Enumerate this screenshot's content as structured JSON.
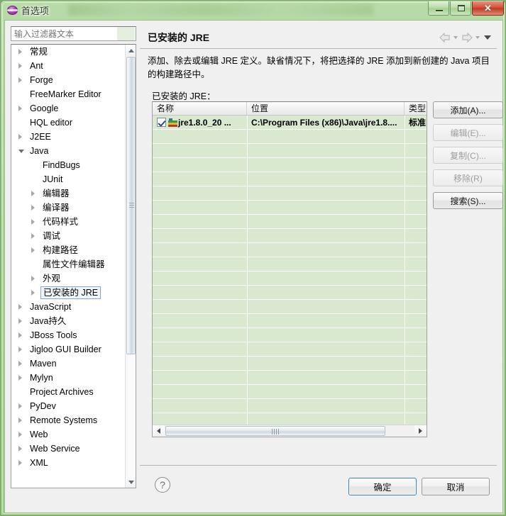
{
  "window": {
    "title": "首选项",
    "icon": "preferences-ball-icon",
    "controls": {
      "minimize": "minimize-icon",
      "maximize": "maximize-icon",
      "close": "✕"
    }
  },
  "sidebar": {
    "filter": {
      "placeholder": "输入过滤器文本",
      "value": ""
    },
    "items": [
      {
        "label": "常规",
        "indent": 0,
        "arrow": "collapsed"
      },
      {
        "label": "Ant",
        "indent": 0,
        "arrow": "collapsed"
      },
      {
        "label": "Forge",
        "indent": 0,
        "arrow": "collapsed"
      },
      {
        "label": "FreeMarker Editor",
        "indent": 0,
        "arrow": "none"
      },
      {
        "label": "Google",
        "indent": 0,
        "arrow": "collapsed"
      },
      {
        "label": "HQL editor",
        "indent": 0,
        "arrow": "none"
      },
      {
        "label": "J2EE",
        "indent": 0,
        "arrow": "collapsed"
      },
      {
        "label": "Java",
        "indent": 0,
        "arrow": "expanded"
      },
      {
        "label": "FindBugs",
        "indent": 1,
        "arrow": "none"
      },
      {
        "label": "JUnit",
        "indent": 1,
        "arrow": "none"
      },
      {
        "label": "编辑器",
        "indent": 1,
        "arrow": "collapsed"
      },
      {
        "label": "编译器",
        "indent": 1,
        "arrow": "collapsed"
      },
      {
        "label": "代码样式",
        "indent": 1,
        "arrow": "collapsed"
      },
      {
        "label": "调试",
        "indent": 1,
        "arrow": "collapsed"
      },
      {
        "label": "构建路径",
        "indent": 1,
        "arrow": "collapsed"
      },
      {
        "label": "属性文件编辑器",
        "indent": 1,
        "arrow": "none"
      },
      {
        "label": "外观",
        "indent": 1,
        "arrow": "collapsed"
      },
      {
        "label": "已安装的 JRE",
        "indent": 1,
        "arrow": "collapsed",
        "selected": true
      },
      {
        "label": "JavaScript",
        "indent": 0,
        "arrow": "collapsed"
      },
      {
        "label": "Java持久",
        "indent": 0,
        "arrow": "collapsed"
      },
      {
        "label": "JBoss Tools",
        "indent": 0,
        "arrow": "collapsed"
      },
      {
        "label": "Jigloo GUI Builder",
        "indent": 0,
        "arrow": "collapsed"
      },
      {
        "label": "Maven",
        "indent": 0,
        "arrow": "collapsed"
      },
      {
        "label": "Mylyn",
        "indent": 0,
        "arrow": "collapsed"
      },
      {
        "label": "Project Archives",
        "indent": 0,
        "arrow": "none"
      },
      {
        "label": "PyDev",
        "indent": 0,
        "arrow": "collapsed"
      },
      {
        "label": "Remote Systems",
        "indent": 0,
        "arrow": "collapsed"
      },
      {
        "label": "Web",
        "indent": 0,
        "arrow": "collapsed"
      },
      {
        "label": "Web Service",
        "indent": 0,
        "arrow": "collapsed"
      },
      {
        "label": "XML",
        "indent": 0,
        "arrow": "collapsed"
      }
    ]
  },
  "page": {
    "title": "已安装的 JRE",
    "description": "添加、除去或编辑 JRE 定义。缺省情况下，将把选择的 JRE 添加到新创建的 Java 项目的构建路径中。",
    "group_label": "已安装的 JRE：",
    "nav": {
      "back": "back-arrow-icon",
      "back_menu": "chevron-down-icon",
      "forward": "forward-arrow-icon",
      "forward_menu": "chevron-down-icon",
      "view_menu": "view-menu-icon"
    }
  },
  "table": {
    "columns": [
      "名称",
      "位置",
      "类型"
    ],
    "rows": [
      {
        "checked": true,
        "icon": "jre-icon",
        "name": "jre1.8.0_20 ...",
        "location": "C:\\Program Files (x86)\\Java\\jre1.8....",
        "type": "标准"
      }
    ]
  },
  "side_buttons": [
    {
      "label": "添加(A)...",
      "name": "add-button",
      "disabled": false
    },
    {
      "label": "编辑(E)...",
      "name": "edit-button",
      "disabled": true
    },
    {
      "label": "复制(C)...",
      "name": "copy-button",
      "disabled": true
    },
    {
      "label": "移除(R)",
      "name": "remove-button",
      "disabled": true
    },
    {
      "label": "搜索(S)...",
      "name": "search-button",
      "disabled": false
    }
  ],
  "footer": {
    "help": "?",
    "ok": "确定",
    "cancel": "取消"
  }
}
